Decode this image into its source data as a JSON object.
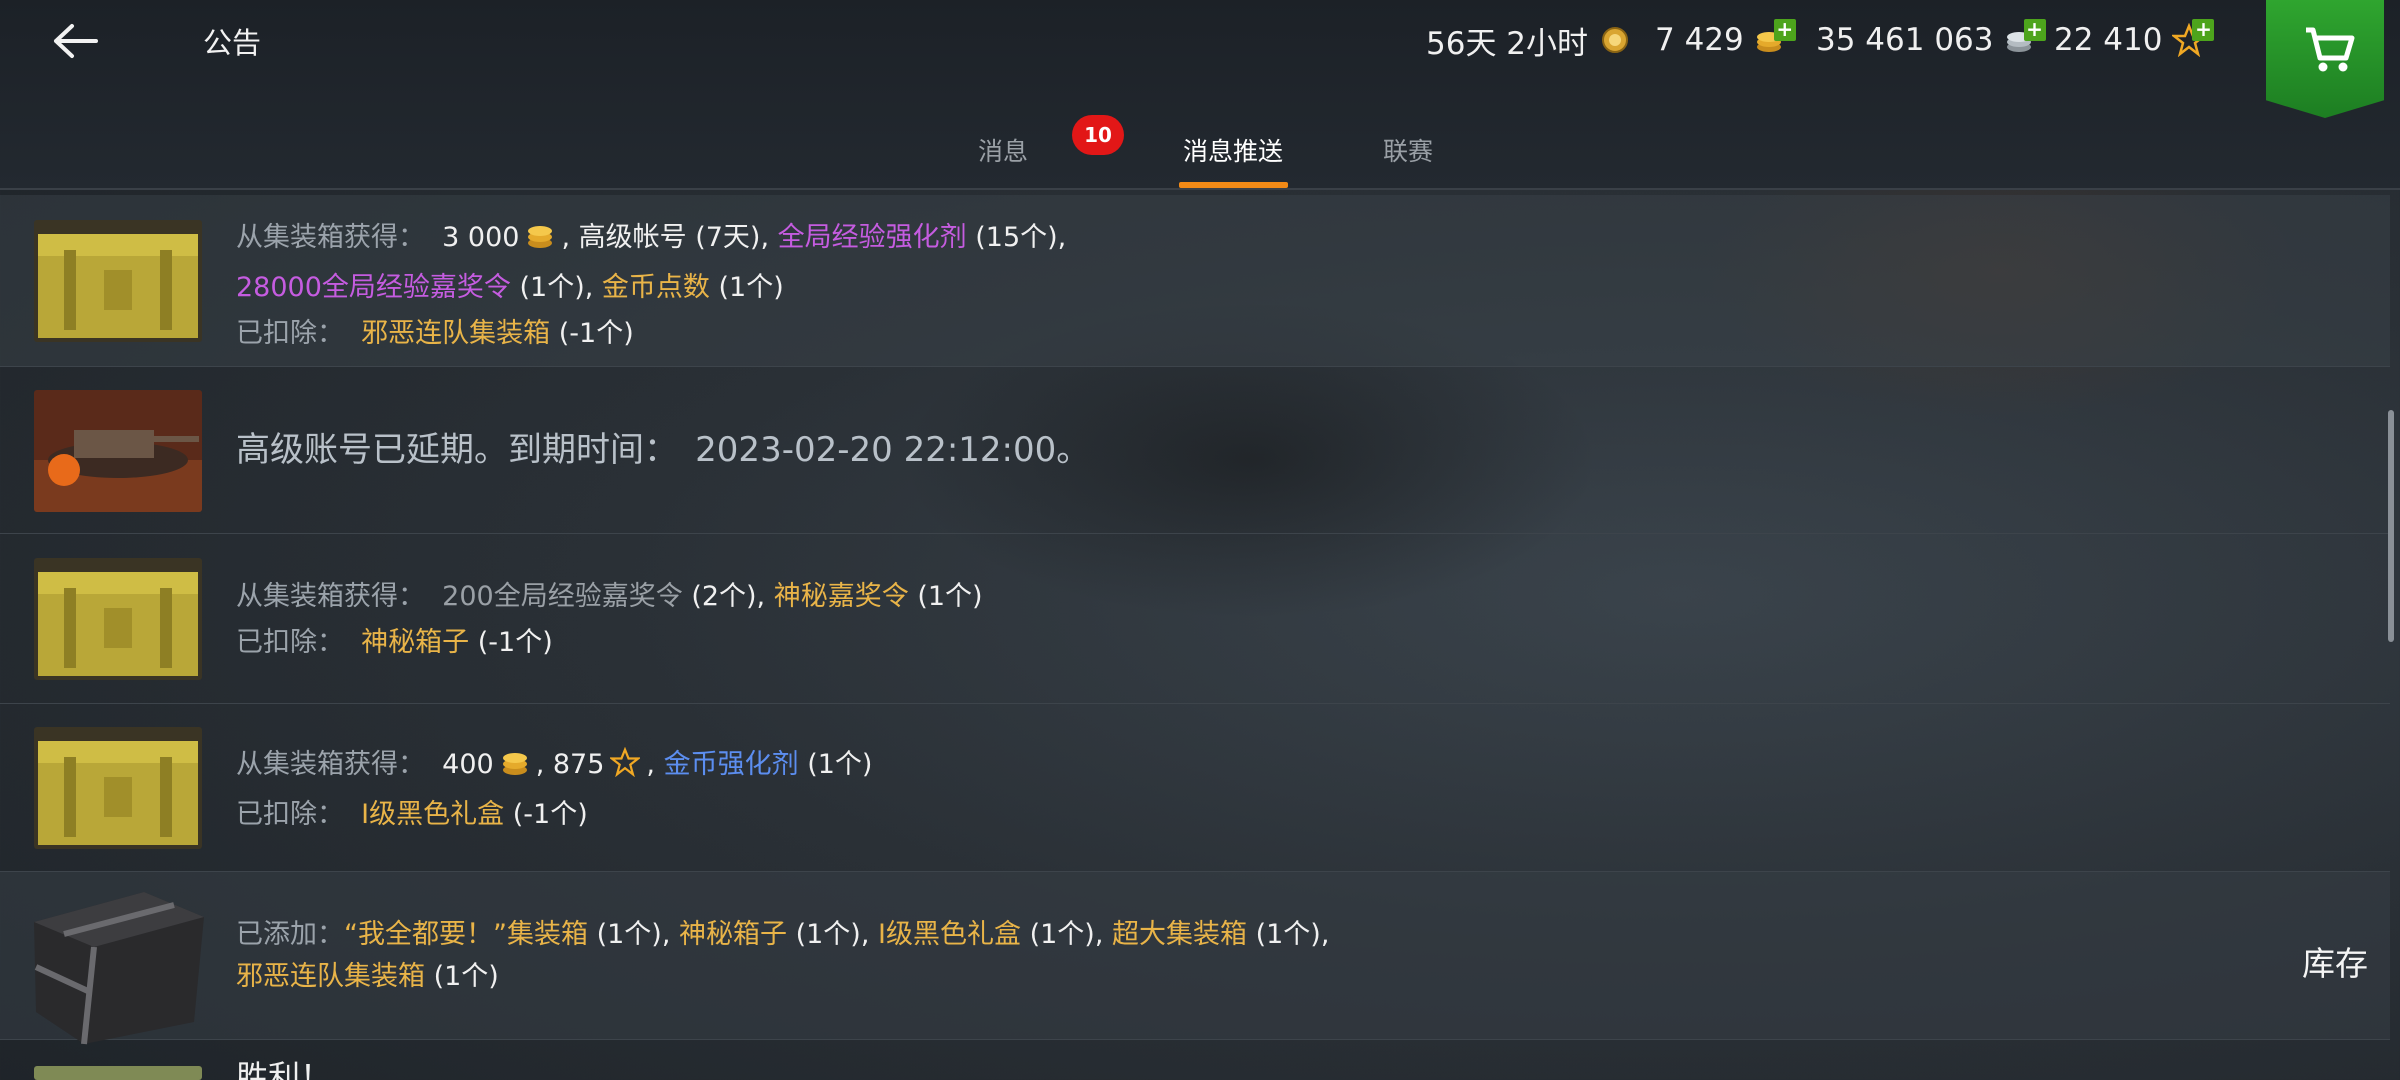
{
  "header": {
    "title": "公告",
    "resources": [
      {
        "value": "56天 2小时",
        "icon": "premium-medal-icon"
      },
      {
        "value": "7 429",
        "icon": "gold-coins-icon"
      },
      {
        "value": "35 461 063",
        "icon": "silver-coins-icon"
      },
      {
        "value": "22 410",
        "icon": "free-xp-star-icon"
      }
    ]
  },
  "tabs": [
    {
      "label": "消息",
      "badge": "10"
    },
    {
      "label": "消息推送",
      "active": true
    },
    {
      "label": "联赛"
    }
  ],
  "messages": [
    {
      "line1_label": "从集装箱获得：",
      "line1_a": "3 000",
      "line1_b": ", 高级帐号 (7天),",
      "line1_c": "全局经验强化剂",
      "line1_d": "(15个),",
      "line2_a": "28000全局经验嘉奖令",
      "line2_b": "(1个),",
      "line2_c": "金币点数",
      "line2_d": "(1个)",
      "line3_label": "已扣除：",
      "line3_a": "邪恶连队集装箱",
      "line3_b": "(-1个)"
    },
    {
      "text_a": "高级账号已延期。到期时间：",
      "text_b": "2023-02-20 22:12:00。"
    },
    {
      "line1_label": "从集装箱获得：",
      "line1_a": "200全局经验嘉奖令",
      "line1_b": "(2个),",
      "line1_c": "神秘嘉奖令",
      "line1_d": "(1个)",
      "line2_label": "已扣除：",
      "line2_a": "神秘箱子",
      "line2_b": "(-1个)"
    },
    {
      "line1_label": "从集装箱获得：",
      "line1_a": "400",
      "line1_b": ", 875",
      "line1_c": ",",
      "line1_d": "金币强化剂",
      "line1_e": "(1个)",
      "line2_label": "已扣除：",
      "line2_a": "I级黑色礼盒",
      "line2_b": "(-1个)"
    },
    {
      "line1_label": "已添加：",
      "items": [
        {
          "name": "“我全都要！”集装箱",
          "count": "(1个),"
        },
        {
          "name": "神秘箱子",
          "count": "(1个),"
        },
        {
          "name": "I级黑色礼盒",
          "count": "(1个),"
        },
        {
          "name": "超大集装箱",
          "count": "(1个),"
        }
      ],
      "line2_name": "邪恶连队集装箱",
      "line2_count": "(1个)",
      "action": "库存"
    },
    {
      "text": "胜利！"
    }
  ]
}
